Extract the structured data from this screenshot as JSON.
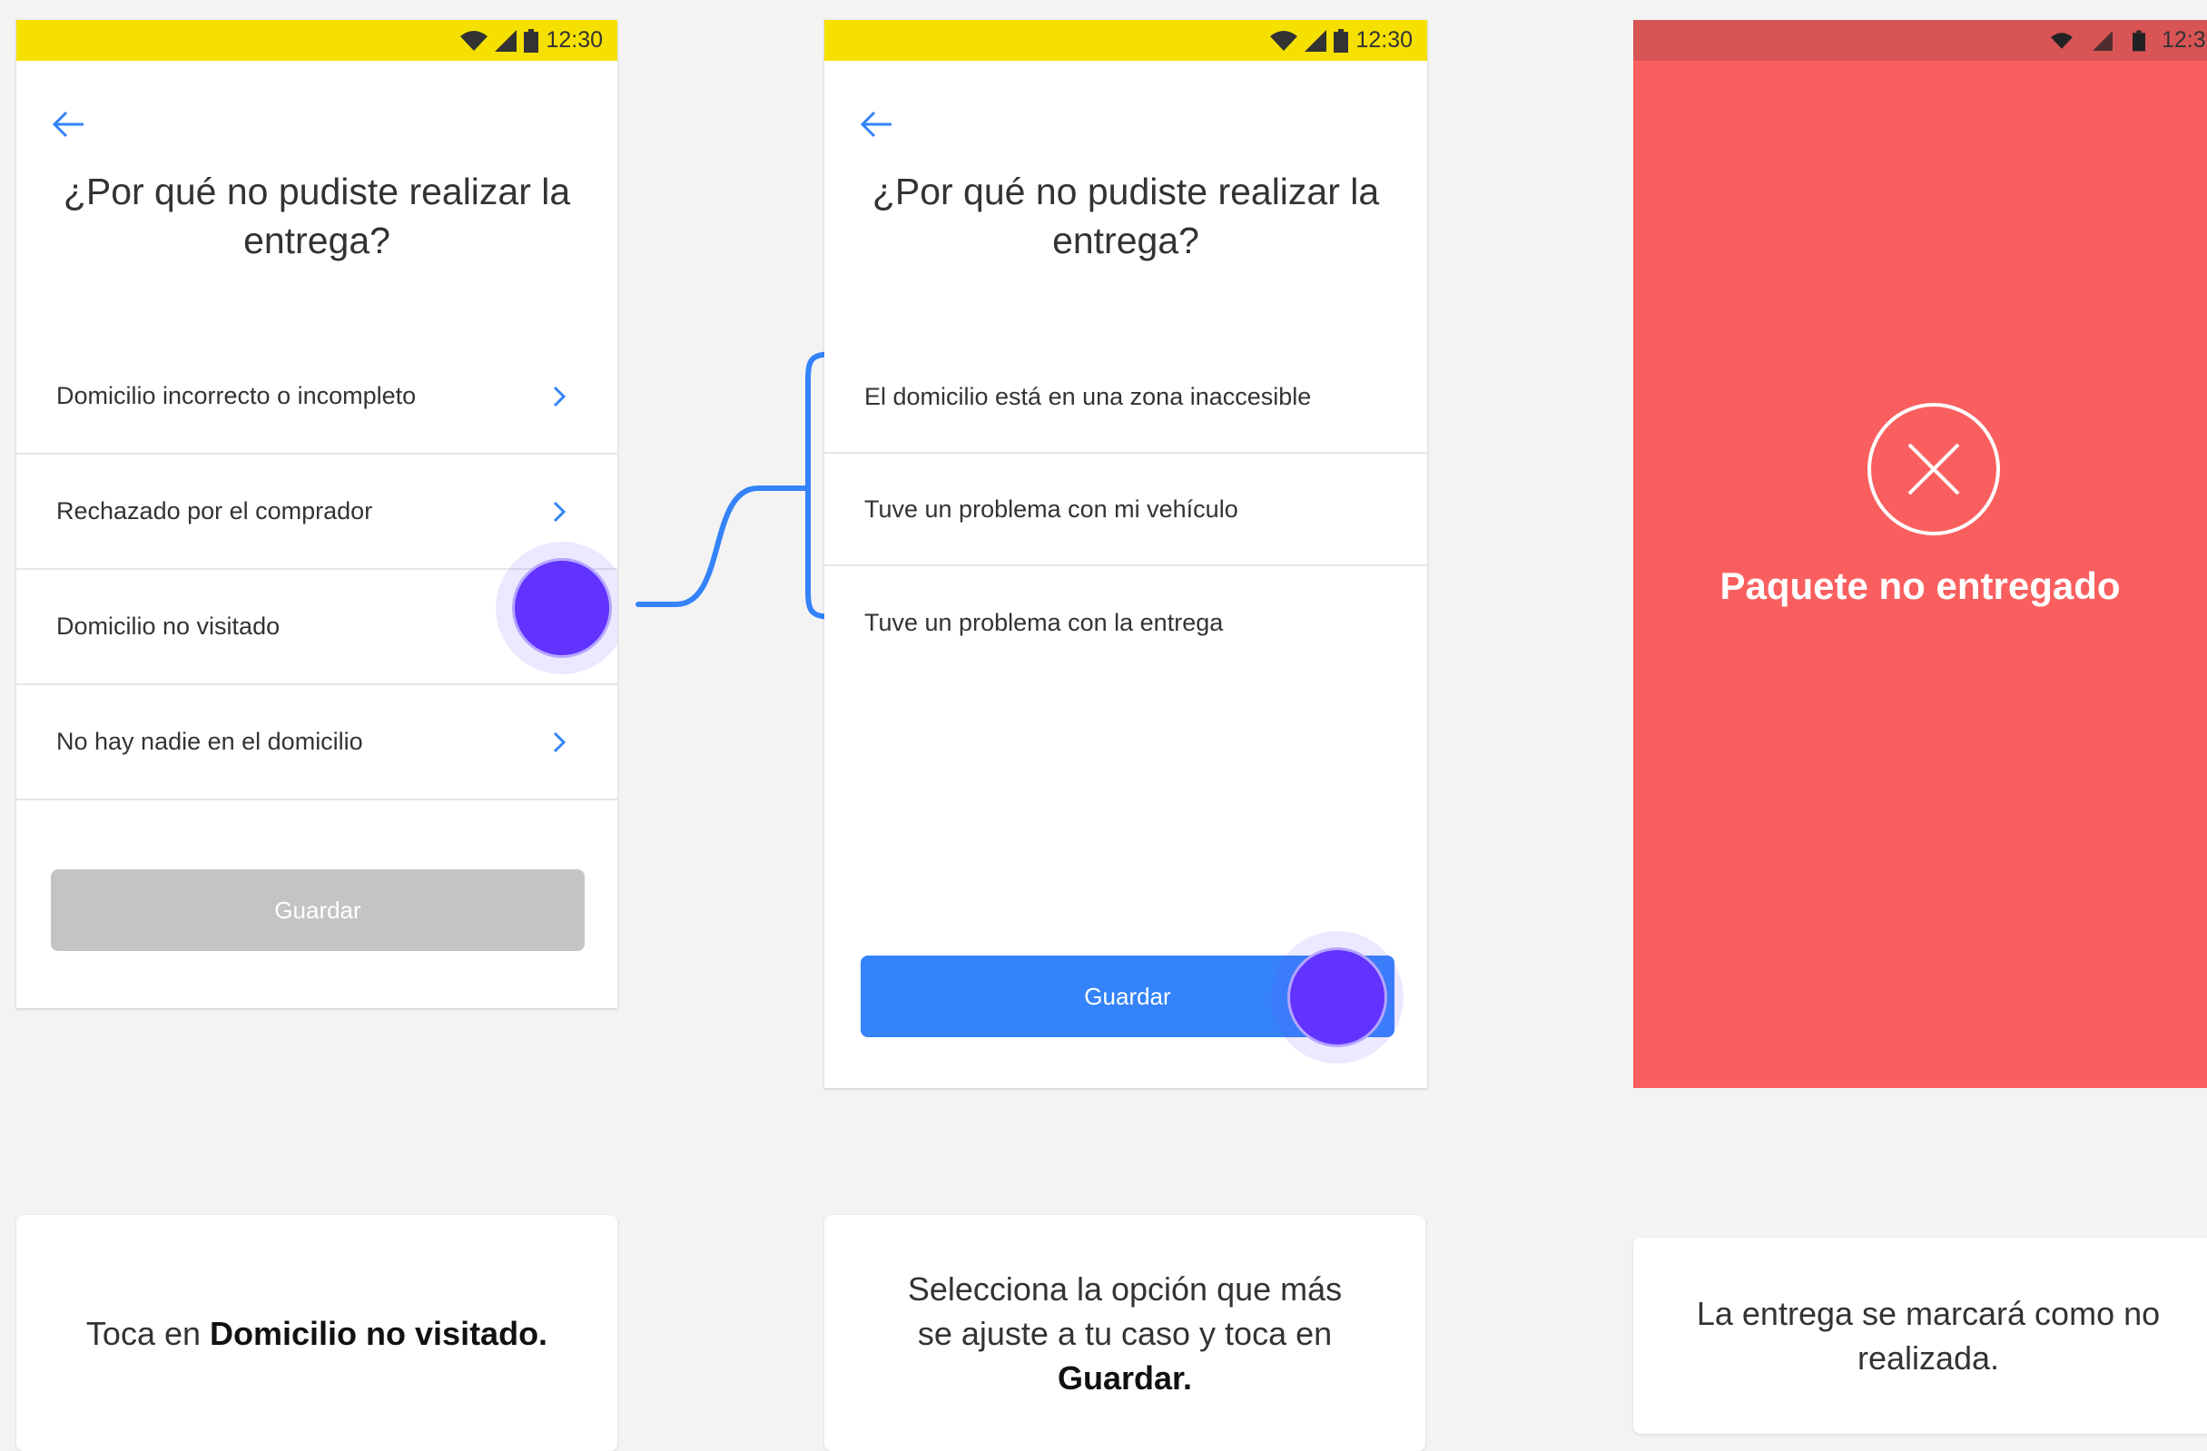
{
  "colors": {
    "yellow_status": "#f5e000",
    "accent_blue": "#3483fa",
    "touch_purple": "#6232ff",
    "disabled_gray": "#c4c4c4",
    "error_red": "#fa5f5f",
    "error_red_status": "#d95454"
  },
  "screen1": {
    "status_time": "12:30",
    "title": "¿Por qué no pudiste realizar la entrega?",
    "options": [
      {
        "label": "Domicilio incorrecto o incompleto"
      },
      {
        "label": "Rechazado por el comprador"
      },
      {
        "label": "Domicilio no visitado"
      },
      {
        "label": "No hay nadie en el domicilio"
      }
    ],
    "save_label": "Guardar"
  },
  "screen2": {
    "status_time": "12:30",
    "title": "¿Por qué no pudiste realizar la entrega?",
    "options": [
      {
        "label": "El domicilio está en una zona inaccesible"
      },
      {
        "label": "Tuve un problema con mi vehículo"
      },
      {
        "label": "Tuve un problema con la entrega"
      }
    ],
    "save_label": "Guardar"
  },
  "screen3": {
    "status_time": "12:3",
    "message": "Paquete no entregado",
    "icon": "close-circle-icon"
  },
  "captions": {
    "step1_prefix": "Toca en ",
    "step1_bold": "Domicilio no visitado.",
    "step2_text": "Selecciona la opción que más se ajuste a tu caso y toca en ",
    "step2_bold": "Guardar.",
    "step3_text": "La entrega se marcará como no realizada."
  }
}
